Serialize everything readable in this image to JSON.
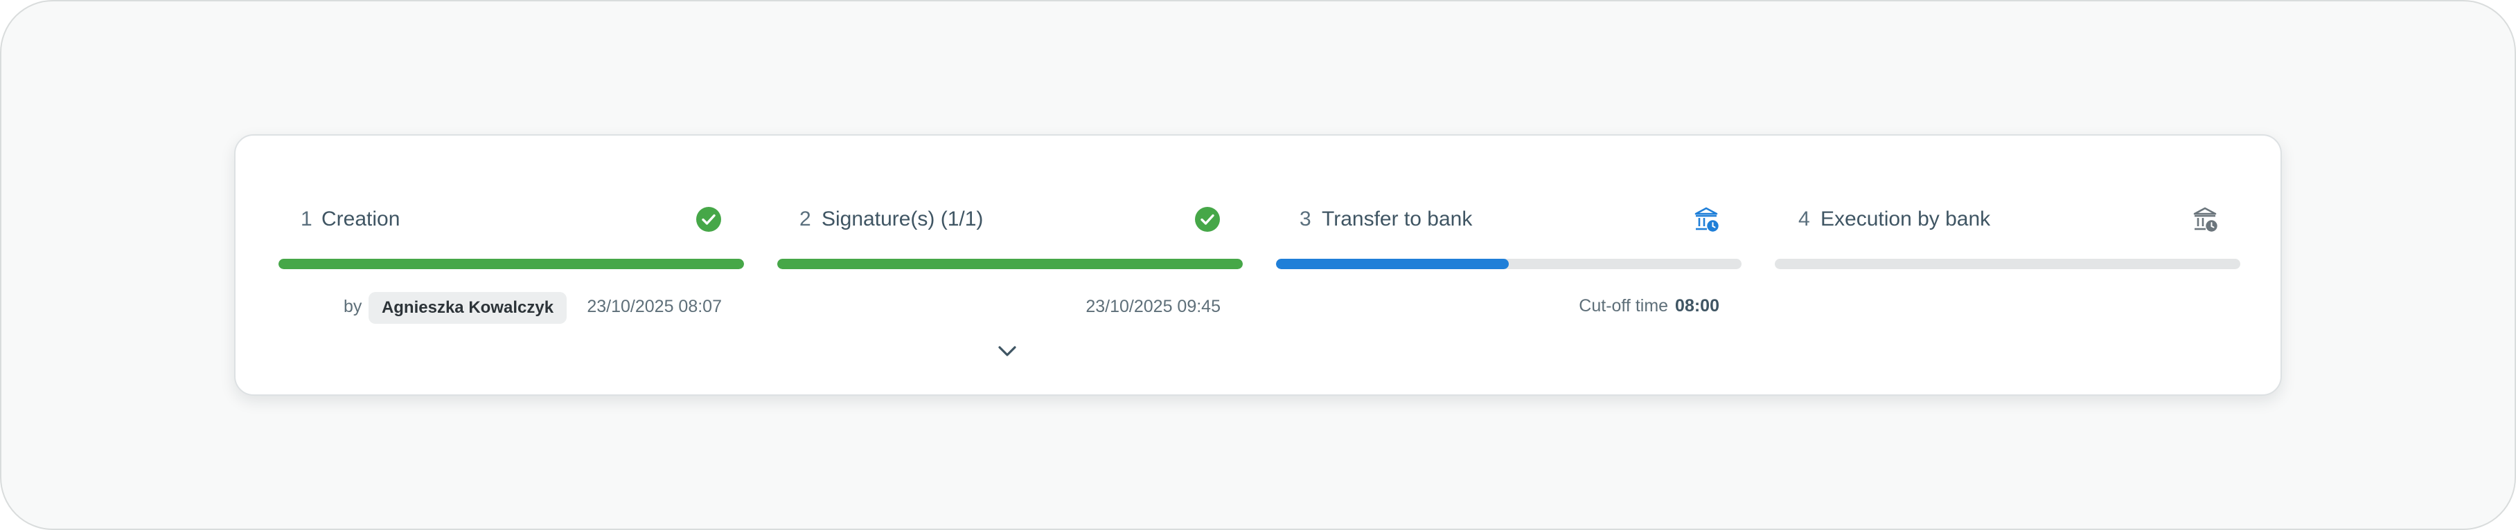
{
  "steps": [
    {
      "number": "1",
      "title": "Creation",
      "status": "completed",
      "status_icon": "check-circle-icon",
      "progress": 1.0,
      "bar_color": "#46a748",
      "by_label": "by",
      "user": "Agnieszka Kowalczyk",
      "timestamp": "23/10/2025 08:07"
    },
    {
      "number": "2",
      "title": "Signature(s) (1/1)",
      "status": "completed",
      "status_icon": "check-circle-icon",
      "progress": 1.0,
      "bar_color": "#46a748",
      "timestamp": "23/10/2025 09:45"
    },
    {
      "number": "3",
      "title": "Transfer to bank",
      "status": "in-progress",
      "status_icon": "bank-clock-icon",
      "progress": 0.5,
      "bar_color": "#1f7fd8",
      "cutoff_label": "Cut-off time",
      "cutoff_time": "08:00"
    },
    {
      "number": "4",
      "title": "Execution by bank",
      "status": "pending",
      "status_icon": "bank-clock-icon",
      "progress": 0.0,
      "bar_color": "#e3e5e6"
    }
  ],
  "colors": {
    "success": "#46a748",
    "active": "#1f7fd8",
    "inactive": "#e3e5e6",
    "pending_icon": "#6b757c"
  },
  "expand_icon": "chevron-down-icon"
}
